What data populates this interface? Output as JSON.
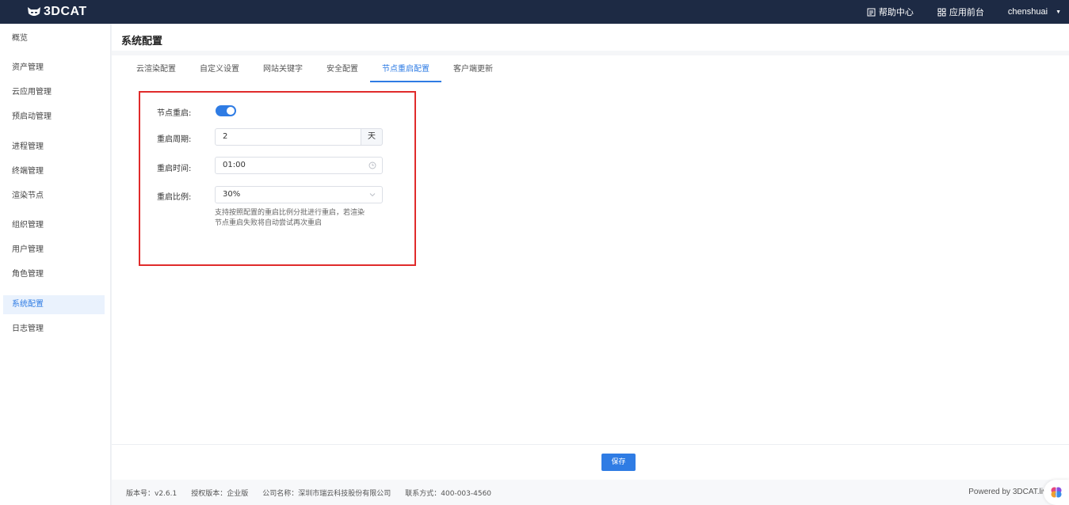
{
  "brand": {
    "name": "3DCAT"
  },
  "topbar": {
    "help_label": "帮助中心",
    "app_front_label": "应用前台",
    "username": "chenshuai"
  },
  "sidebar": {
    "items": [
      {
        "label": "概览",
        "active": false
      },
      {
        "label": "资产管理",
        "active": false
      },
      {
        "label": "云应用管理",
        "active": false
      },
      {
        "label": "预启动管理",
        "active": false
      },
      {
        "label": "进程管理",
        "active": false
      },
      {
        "label": "终端管理",
        "active": false
      },
      {
        "label": "渲染节点",
        "active": false
      },
      {
        "label": "组织管理",
        "active": false
      },
      {
        "label": "用户管理",
        "active": false
      },
      {
        "label": "角色管理",
        "active": false
      },
      {
        "label": "系统配置",
        "active": true
      },
      {
        "label": "日志管理",
        "active": false
      }
    ]
  },
  "main": {
    "title": "系统配置",
    "tabs": [
      {
        "label": "云渲染配置",
        "active": false
      },
      {
        "label": "自定义设置",
        "active": false
      },
      {
        "label": "网站关键字",
        "active": false
      },
      {
        "label": "安全配置",
        "active": false
      },
      {
        "label": "节点重启配置",
        "active": true
      },
      {
        "label": "客户端更新",
        "active": false
      }
    ],
    "form": {
      "restart_label": "节点重启:",
      "restart_enabled": true,
      "period_label": "重启周期:",
      "period_value": "2",
      "period_unit": "天",
      "time_label": "重启时间:",
      "time_value": "01:00",
      "ratio_label": "重启比例:",
      "ratio_value": "30%",
      "hint_line1": "支持按照配置的重启比例分批进行重启，若渲染",
      "hint_line2": "节点重启失败将自动尝试再次重启"
    },
    "save_label": "保存"
  },
  "footer": {
    "version": "版本号：v2.6.1",
    "license": "授权版本：企业版",
    "company": "公司名称：深圳市瑞云科技股份有限公司",
    "contact": "联系方式：400-003-4560",
    "powered": "Powered by 3DCAT.liv"
  },
  "colors": {
    "topbar": "#1d2a44",
    "accent": "#2f7ce4",
    "highlight": "#e02b2b"
  },
  "icons": [
    "cat-logo-icon",
    "help-doc-icon",
    "app-grid-icon",
    "caret-down-icon",
    "clock-icon",
    "chevron-down-icon",
    "brain-icon"
  ]
}
